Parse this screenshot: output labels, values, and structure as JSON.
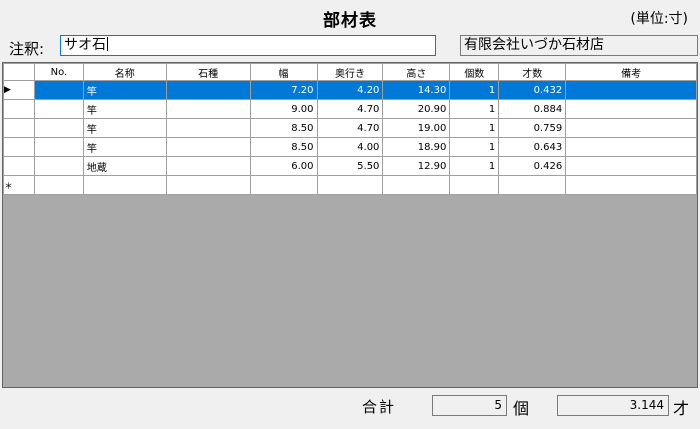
{
  "title": "部材表",
  "unit_label": "(単位:寸)",
  "note": {
    "label": "注釈:",
    "value": "サオ石"
  },
  "company": "有限会社いづか石材店",
  "table": {
    "columns": [
      "No.",
      "名称",
      "石種",
      "幅",
      "奥行き",
      "高さ",
      "個数",
      "才数",
      "備考"
    ],
    "rows": [
      {
        "no": "",
        "name": "竿",
        "stone": "",
        "width": "7.20",
        "depth": "4.20",
        "height": "14.30",
        "count": "1",
        "sai": "0.432",
        "note": ""
      },
      {
        "no": "",
        "name": "竿",
        "stone": "",
        "width": "9.00",
        "depth": "4.70",
        "height": "20.90",
        "count": "1",
        "sai": "0.884",
        "note": ""
      },
      {
        "no": "",
        "name": "竿",
        "stone": "",
        "width": "8.50",
        "depth": "4.70",
        "height": "19.00",
        "count": "1",
        "sai": "0.759",
        "note": ""
      },
      {
        "no": "",
        "name": "竿",
        "stone": "",
        "width": "8.50",
        "depth": "4.00",
        "height": "18.90",
        "count": "1",
        "sai": "0.643",
        "note": ""
      },
      {
        "no": "",
        "name": "地蔵",
        "stone": "",
        "width": "6.00",
        "depth": "5.50",
        "height": "12.90",
        "count": "1",
        "sai": "0.426",
        "note": ""
      }
    ],
    "current_marker": "▶",
    "new_row_marker": "＊"
  },
  "footer": {
    "total_label": "合計",
    "count_total": "5",
    "count_unit": "個",
    "sai_total": "3.144",
    "sai_unit": "才"
  },
  "colors": {
    "selection": "#0078d7",
    "grid_background": "#aaaaaa"
  }
}
